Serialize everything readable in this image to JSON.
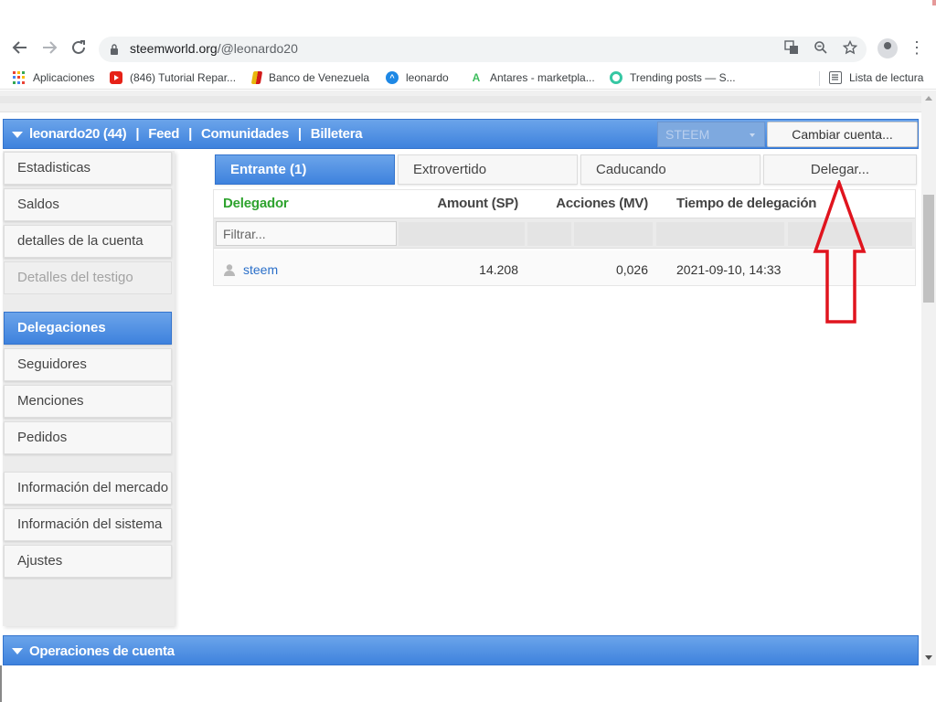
{
  "browser": {
    "url_host": "steemworld.org",
    "url_path": "/@leonardo20",
    "bookmarks": [
      {
        "label": "Aplicaciones",
        "icon": "apps-grid-icon"
      },
      {
        "label": "(846) Tutorial Repar...",
        "icon": "youtube-icon"
      },
      {
        "label": "Banco de Venezuela",
        "icon": "banco-venezuela-icon"
      },
      {
        "label": "leonardo",
        "icon": "leonardo-icon"
      },
      {
        "label": "Antares - marketpla...",
        "icon": "antares-icon"
      },
      {
        "label": "Trending posts — S...",
        "icon": "trending-icon"
      },
      {
        "label": "Lista de lectura",
        "icon": "reading-list-icon"
      }
    ]
  },
  "header": {
    "account": "leonardo20 (44)",
    "sep": "|",
    "links": [
      "Feed",
      "Comunidades",
      "Billetera"
    ],
    "currency": "STEEM",
    "switch_account": "Cambiar cuenta..."
  },
  "sidebar": {
    "items": [
      {
        "label": "Estadisticas",
        "state": "normal"
      },
      {
        "label": "Saldos",
        "state": "normal"
      },
      {
        "label": "detalles de la cuenta",
        "state": "normal"
      },
      {
        "label": "Detalles del testigo",
        "state": "disabled"
      },
      {
        "label": "Delegaciones",
        "state": "active"
      },
      {
        "label": "Seguidores",
        "state": "normal"
      },
      {
        "label": "Menciones",
        "state": "normal"
      },
      {
        "label": "Pedidos",
        "state": "normal"
      },
      {
        "label": "Información del mercado",
        "state": "normal"
      },
      {
        "label": "Información del sistema",
        "state": "normal"
      },
      {
        "label": "Ajustes",
        "state": "normal"
      }
    ]
  },
  "tabs": [
    {
      "label": "Entrante (1)",
      "active": true
    },
    {
      "label": "Extrovertido",
      "active": false
    },
    {
      "label": "Caducando",
      "active": false
    },
    {
      "label": "Delegar...",
      "active": false
    }
  ],
  "table": {
    "headers": [
      "Delegador",
      "Amount (SP)",
      "Acciones (MV)",
      "Tiempo de delegación"
    ],
    "filter_placeholder": "Filtrar...",
    "rows": [
      {
        "delegator": "steem",
        "amount": "14.208",
        "shares": "0,026",
        "time": "2021-09-10, 14:33"
      }
    ]
  },
  "operations": {
    "title": "Operaciones de cuenta"
  },
  "colors": {
    "accent_blue": "#3e82dd",
    "header_green": "#2fa32f",
    "annotation_red": "#e0141e"
  }
}
